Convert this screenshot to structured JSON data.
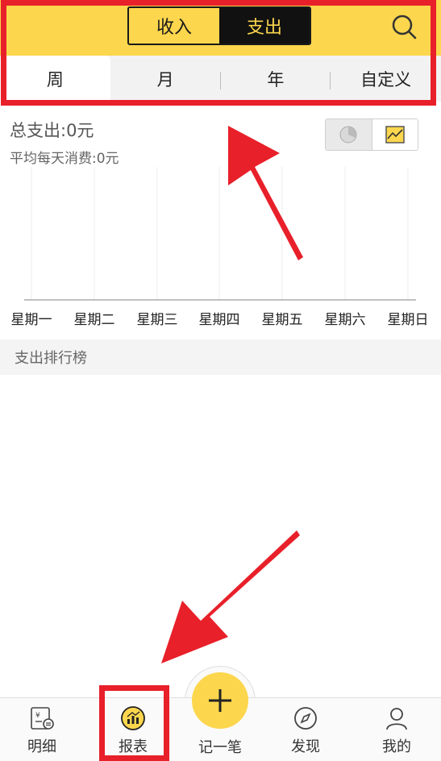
{
  "header": {
    "segments": [
      {
        "label": "收入",
        "active": false
      },
      {
        "label": "支出",
        "active": true
      }
    ],
    "search_icon": "search-icon"
  },
  "period_tabs": [
    {
      "label": "周",
      "active": true
    },
    {
      "label": "月",
      "active": false
    },
    {
      "label": "年",
      "active": false
    },
    {
      "label": "自定义",
      "active": false
    }
  ],
  "summary": {
    "total": "总支出:0元",
    "average": "平均每天消费:0元"
  },
  "chart_toggle": {
    "pie_icon": "pie-chart-icon",
    "line_icon": "line-chart-icon",
    "selected": "line"
  },
  "chart_data": {
    "type": "line",
    "categories": [
      "星期一",
      "星期二",
      "星期三",
      "星期四",
      "星期五",
      "星期六",
      "星期日"
    ],
    "values": [
      0,
      0,
      0,
      0,
      0,
      0,
      0
    ]
  },
  "ranking": {
    "title": "支出排行榜"
  },
  "bottom_nav": {
    "items": [
      {
        "label": "明细",
        "icon": "ledger-icon"
      },
      {
        "label": "报表",
        "icon": "report-icon",
        "active": true
      },
      {
        "label": "记一笔",
        "icon": "plus-icon"
      },
      {
        "label": "发现",
        "icon": "compass-icon"
      },
      {
        "label": "我的",
        "icon": "user-icon"
      }
    ]
  },
  "colors": {
    "brand": "#fcd64d",
    "highlight": "#e8202a",
    "dark": "#111111"
  }
}
